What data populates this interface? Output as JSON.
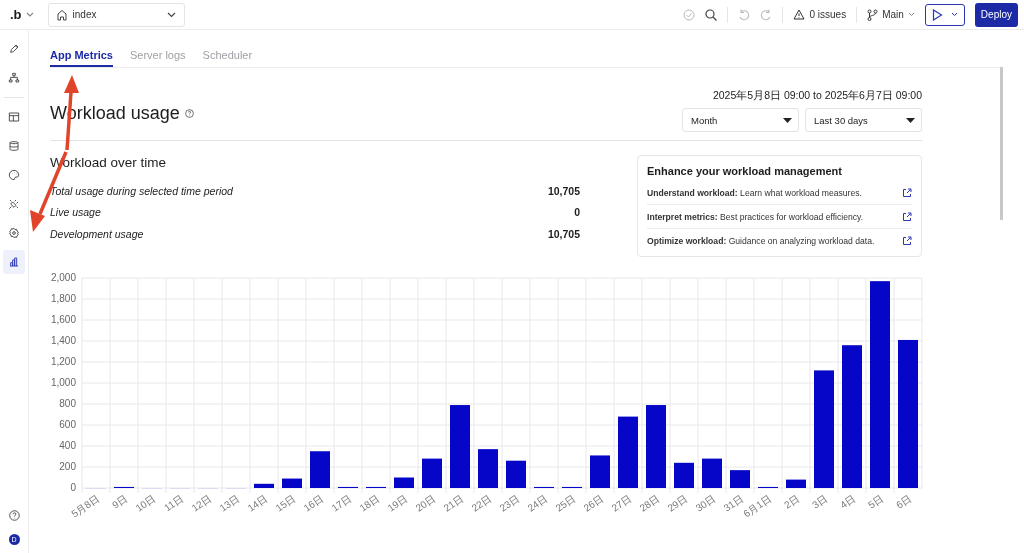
{
  "top_bar": {
    "logo": ".b",
    "page_select": {
      "value": "index"
    },
    "issues": "0 issues",
    "branch": "Main",
    "deploy": "Deploy"
  },
  "sidebar": {
    "items": [
      {
        "kind": "pencil",
        "selected": false
      },
      {
        "kind": "sitemap",
        "selected": false
      },
      {
        "kind": "layout",
        "selected": false
      },
      {
        "kind": "database",
        "selected": false
      },
      {
        "kind": "palette",
        "selected": false
      },
      {
        "kind": "plug",
        "selected": false
      },
      {
        "kind": "gear",
        "selected": false
      },
      {
        "kind": "chart",
        "selected": true
      }
    ],
    "avatar": "D"
  },
  "tabs": [
    {
      "label": "App Metrics",
      "selected": true
    },
    {
      "label": "Server logs",
      "selected": false
    },
    {
      "label": "Scheduler",
      "selected": false
    }
  ],
  "header": {
    "title": "Workload usage",
    "date_range": "2025年5月8日 09:00 to 2025年6月7日 09:00",
    "interval": {
      "value": "Month"
    },
    "period": {
      "value": "Last 30 days"
    }
  },
  "summary": {
    "title": "Workload over time",
    "rows": [
      {
        "label": "Total usage during selected time period",
        "value": "10,705"
      },
      {
        "label": "Live usage",
        "value": "0"
      },
      {
        "label": "Development usage",
        "value": "10,705"
      }
    ]
  },
  "resources": {
    "title": "Enhance your workload management",
    "links": [
      {
        "text": "**Understand workload:** Learn what workload measures."
      },
      {
        "text": "**Interpret metrics:** Best practices for workload efficiency."
      },
      {
        "text": "**Optimize workload:** Guidance on analyzing workload data."
      }
    ]
  },
  "chart_data": {
    "type": "bar",
    "categories": [
      "5月8日",
      "9日",
      "10日",
      "11日",
      "12日",
      "13日",
      "14日",
      "15日",
      "16日",
      "17日",
      "18日",
      "19日",
      "20日",
      "21日",
      "22日",
      "23日",
      "24日",
      "25日",
      "26日",
      "27日",
      "28日",
      "29日",
      "30日",
      "31日",
      "6月1日",
      "2日",
      "3日",
      "4日",
      "5日",
      "6日"
    ],
    "series": [
      {
        "color": "#0606c8",
        "values": [
          0,
          10,
          0,
          0,
          0,
          0,
          40,
          90,
          350,
          10,
          10,
          100,
          280,
          790,
          370,
          260,
          10,
          10,
          310,
          680,
          790,
          240,
          280,
          170,
          10,
          80,
          1120,
          1360,
          1970,
          1410
        ]
      }
    ],
    "grid": true,
    "ylim": [
      0,
      2000
    ],
    "yticks": [
      0,
      200,
      400,
      600,
      800,
      {
        "value": 1000,
        "label": "1,000"
      },
      {
        "value": 1200,
        "label": "1,200"
      },
      {
        "value": 1400,
        "label": "1,400"
      },
      {
        "value": 1600,
        "label": "1,600"
      },
      {
        "value": 1800,
        "label": "1,800"
      },
      {
        "value": 2000,
        "label": "2,000"
      }
    ]
  }
}
